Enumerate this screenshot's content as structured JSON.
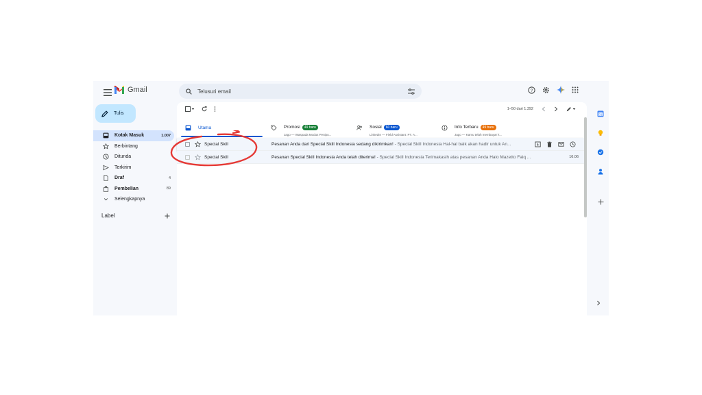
{
  "header": {
    "app_name": "Gmail",
    "search_placeholder": "Telusuri email"
  },
  "compose": {
    "label": "Tulis"
  },
  "sidebar": {
    "items": [
      {
        "label": "Kotak Masuk",
        "count": "1.007",
        "icon": "inbox-icon",
        "active": true
      },
      {
        "label": "Berbintang",
        "count": "",
        "icon": "star-icon"
      },
      {
        "label": "Ditunda",
        "count": "",
        "icon": "clock-icon"
      },
      {
        "label": "Terkirim",
        "count": "",
        "icon": "send-icon"
      },
      {
        "label": "Draf",
        "count": "4",
        "icon": "draft-icon",
        "bold": true
      },
      {
        "label": "Pembelian",
        "count": "89",
        "icon": "shopping-bag-icon",
        "bold": true
      },
      {
        "label": "Selengkapnya",
        "count": "",
        "icon": "chevron-down-icon"
      }
    ],
    "label_header": "Label"
  },
  "toolbar": {
    "pagination": "1–50 dari 1.392"
  },
  "tabs": [
    {
      "name": "Utama",
      "icon": "inbox-icon",
      "active": true
    },
    {
      "name": "Promosi",
      "badge": "49 baru",
      "badge_color": "#188038",
      "sub": "Jago — Waspada Modus Penipu...",
      "icon": "tag-icon"
    },
    {
      "name": "Sosial",
      "badge": "60 baru",
      "badge_color": "#0b57d0",
      "sub": "LinkedIn — Field Assistant: PT. A...",
      "icon": "people-icon"
    },
    {
      "name": "Info Terbaru",
      "badge": "49 baru",
      "badge_color": "#e8710a",
      "sub": "Jago — Kamu telah membayar k...",
      "icon": "info-icon"
    }
  ],
  "emails": [
    {
      "sender": "Special Skill",
      "subject": "Pesanan Anda dari Special Skill Indonesia sedang dikirimkan!",
      "snippet": " - Special Skill Indonesia Hal-hal baik akan hadir untuk An...",
      "time": "",
      "unread": true
    },
    {
      "sender": "Special Skill",
      "subject": "Pesanan Special Skill Indonesia Anda telah diterima!",
      "snippet": " - Special Skill Indonesia Terimakasih atas pesanan Anda Halo Mazetto Faiq ...",
      "time": "16.06",
      "unread": false
    }
  ],
  "colors": {
    "accent": "#0b57d0",
    "compose_bg": "#c2e7ff",
    "active_nav": "#d3e3fd",
    "annotation": "#e53935"
  }
}
